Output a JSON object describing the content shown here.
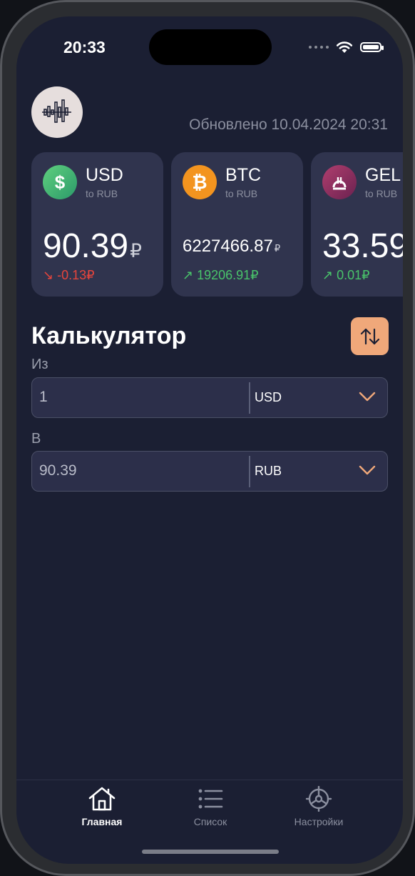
{
  "status_bar": {
    "time": "20:33"
  },
  "header": {
    "updated": "Обновлено 10.04.2024 20:31"
  },
  "cards": [
    {
      "code": "USD",
      "sub": "to RUB",
      "rate": "90.39",
      "rate_suffix": "₽",
      "change": "-0.13₽",
      "change_arrow": "↘",
      "trend": "down",
      "icon": "dollar-icon",
      "icon_color": "#3cb06c"
    },
    {
      "code": "BTC",
      "sub": "to RUB",
      "rate": "6227466.87",
      "rate_suffix": "₽",
      "change": "19206.91₽",
      "change_arrow": "↗",
      "trend": "up",
      "icon": "bitcoin-icon",
      "icon_color": "#f3941f"
    },
    {
      "code": "GEL",
      "sub": "to RUB",
      "rate": "33.59",
      "rate_suffix": "",
      "change": "0.01₽",
      "change_arrow": "↗",
      "trend": "up",
      "icon": "lari-icon",
      "icon_color": "#8a2a5e"
    }
  ],
  "calculator": {
    "title": "Калькулятор",
    "from": {
      "label": "Из",
      "value": "1",
      "currency": "USD"
    },
    "to": {
      "label": "В",
      "value": "90.39",
      "currency": "RUB"
    }
  },
  "tabs": [
    {
      "label": "Главная",
      "icon": "home-icon",
      "active": true
    },
    {
      "label": "Список",
      "icon": "list-icon",
      "active": false
    },
    {
      "label": "Настройки",
      "icon": "settings-icon",
      "active": false
    }
  ],
  "colors": {
    "background": "#1b1f33",
    "card": "#30344e",
    "accent": "#f0a87a",
    "negative": "#e8453c",
    "positive": "#49c46a"
  }
}
